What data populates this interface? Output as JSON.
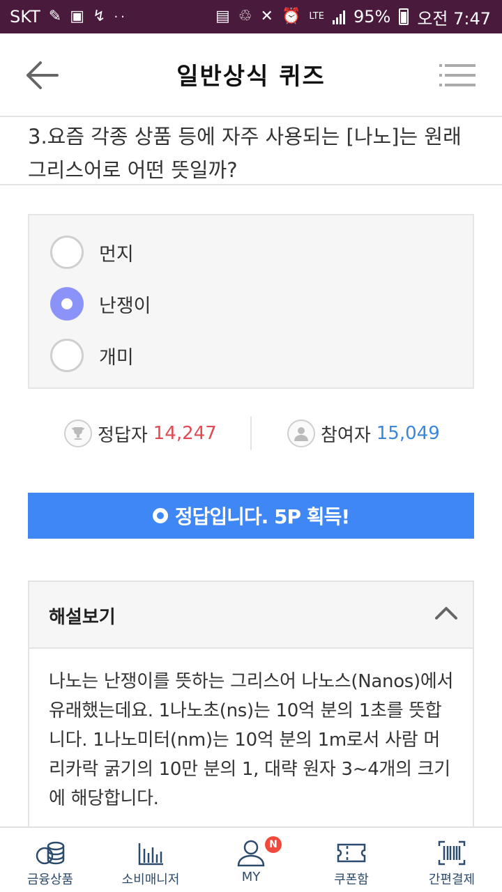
{
  "status_bar": {
    "carrier": "SKT",
    "network": "LTE",
    "battery": "95%",
    "time": "오전 7:47"
  },
  "header": {
    "title": "일반상식 퀴즈",
    "back_icon": "arrow-left-icon",
    "menu_icon": "list-menu-icon"
  },
  "question": {
    "text": "3.요즘 각종 상품 등에 자주 사용되는 [나노]는 원래 그리스어로 어떤 뜻일까?"
  },
  "options": [
    {
      "label": "먼지",
      "selected": false
    },
    {
      "label": "난쟁이",
      "selected": true
    },
    {
      "label": "개미",
      "selected": false
    }
  ],
  "stats": {
    "correct_label": "정답자",
    "correct_count": "14,247",
    "participant_label": "참여자",
    "participant_count": "15,049",
    "correct_icon": "trophy-icon",
    "participant_icon": "person-icon"
  },
  "result": {
    "message": "정답입니다. 5P 획득!",
    "color": "#3f87f5"
  },
  "explanation": {
    "title": "해설보기",
    "body": "나노는 난쟁이를 뜻하는 그리스어 나노스(Nanos)에서 유래했는데요. 1나노초(ns)는 10억 분의 1초를 뜻합니다. 1나노미터(nm)는 10억 분의 1m로서 사람 머리카락 굵기의 10만 분의 1, 대략 원자 3~4개의 크기에 해당합니다."
  },
  "bottom_nav": {
    "items": [
      {
        "label": "금융상품",
        "icon": "coins-icon"
      },
      {
        "label": "소비매니저",
        "icon": "bar-chart-icon"
      },
      {
        "label": "MY",
        "icon": "user-icon",
        "badge": "N"
      },
      {
        "label": "쿠폰함",
        "icon": "ticket-icon"
      },
      {
        "label": "간편결제",
        "icon": "barcode-icon"
      }
    ]
  }
}
